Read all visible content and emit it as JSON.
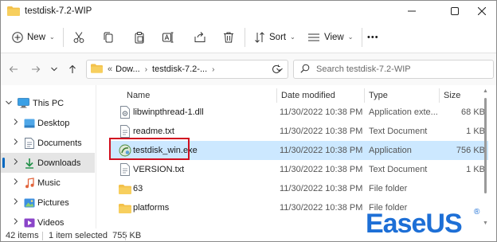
{
  "window": {
    "title": "testdisk-7.2-WIP",
    "controls": [
      "minimize",
      "maximize",
      "close"
    ]
  },
  "toolbar": {
    "new_label": "New",
    "sort_label": "Sort",
    "view_label": "View",
    "more_label": "•••"
  },
  "nav": {
    "address": {
      "prefix": "«",
      "segments": [
        "Dow...",
        "testdisk-7.2-..."
      ]
    },
    "search": {
      "placeholder": "Search testdisk-7.2-WIP"
    }
  },
  "sidebar": {
    "items": [
      {
        "label": "This PC",
        "icon": "pc-icon",
        "level": 0,
        "expanded": true
      },
      {
        "label": "Desktop",
        "icon": "desktop-icon",
        "level": 1
      },
      {
        "label": "Documents",
        "icon": "documents-icon",
        "level": 1
      },
      {
        "label": "Downloads",
        "icon": "downloads-icon",
        "level": 1,
        "selected": true
      },
      {
        "label": "Music",
        "icon": "music-icon",
        "level": 1
      },
      {
        "label": "Pictures",
        "icon": "pictures-icon",
        "level": 1
      },
      {
        "label": "Videos",
        "icon": "videos-icon",
        "level": 1
      }
    ]
  },
  "columns": {
    "name": "Name",
    "date": "Date modified",
    "type": "Type",
    "size": "Size"
  },
  "files": [
    {
      "name": "libwinpthread-1.dll",
      "date": "11/30/2022 10:38 PM",
      "type": "Application exte...",
      "size": "68 KB",
      "icon": "dll-file-icon"
    },
    {
      "name": "readme.txt",
      "date": "11/30/2022 10:38 PM",
      "type": "Text Document",
      "size": "1 KB",
      "icon": "text-file-icon"
    },
    {
      "name": "testdisk_win.exe",
      "date": "11/30/2022 10:38 PM",
      "type": "Application",
      "size": "756 KB",
      "icon": "exe-file-icon",
      "selected": true
    },
    {
      "name": "VERSION.txt",
      "date": "11/30/2022 10:38 PM",
      "type": "Text Document",
      "size": "1 KB",
      "icon": "text-file-icon"
    },
    {
      "name": "63",
      "date": "11/30/2022 10:38 PM",
      "type": "File folder",
      "size": "",
      "icon": "folder-icon"
    },
    {
      "name": "platforms",
      "date": "11/30/2022 10:38 PM",
      "type": "File folder",
      "size": "",
      "icon": "folder-icon"
    }
  ],
  "status": {
    "items": "42 items",
    "selected": "1 item selected  755 KB"
  },
  "logo": {
    "text": "EaseUS",
    "mark": "®"
  },
  "colors": {
    "accent": "#0067c0",
    "selection": "#cce8ff",
    "highlight_box": "#d10f1f",
    "folder": "#f3c14b",
    "logo_blue": "#1d6fd6"
  }
}
